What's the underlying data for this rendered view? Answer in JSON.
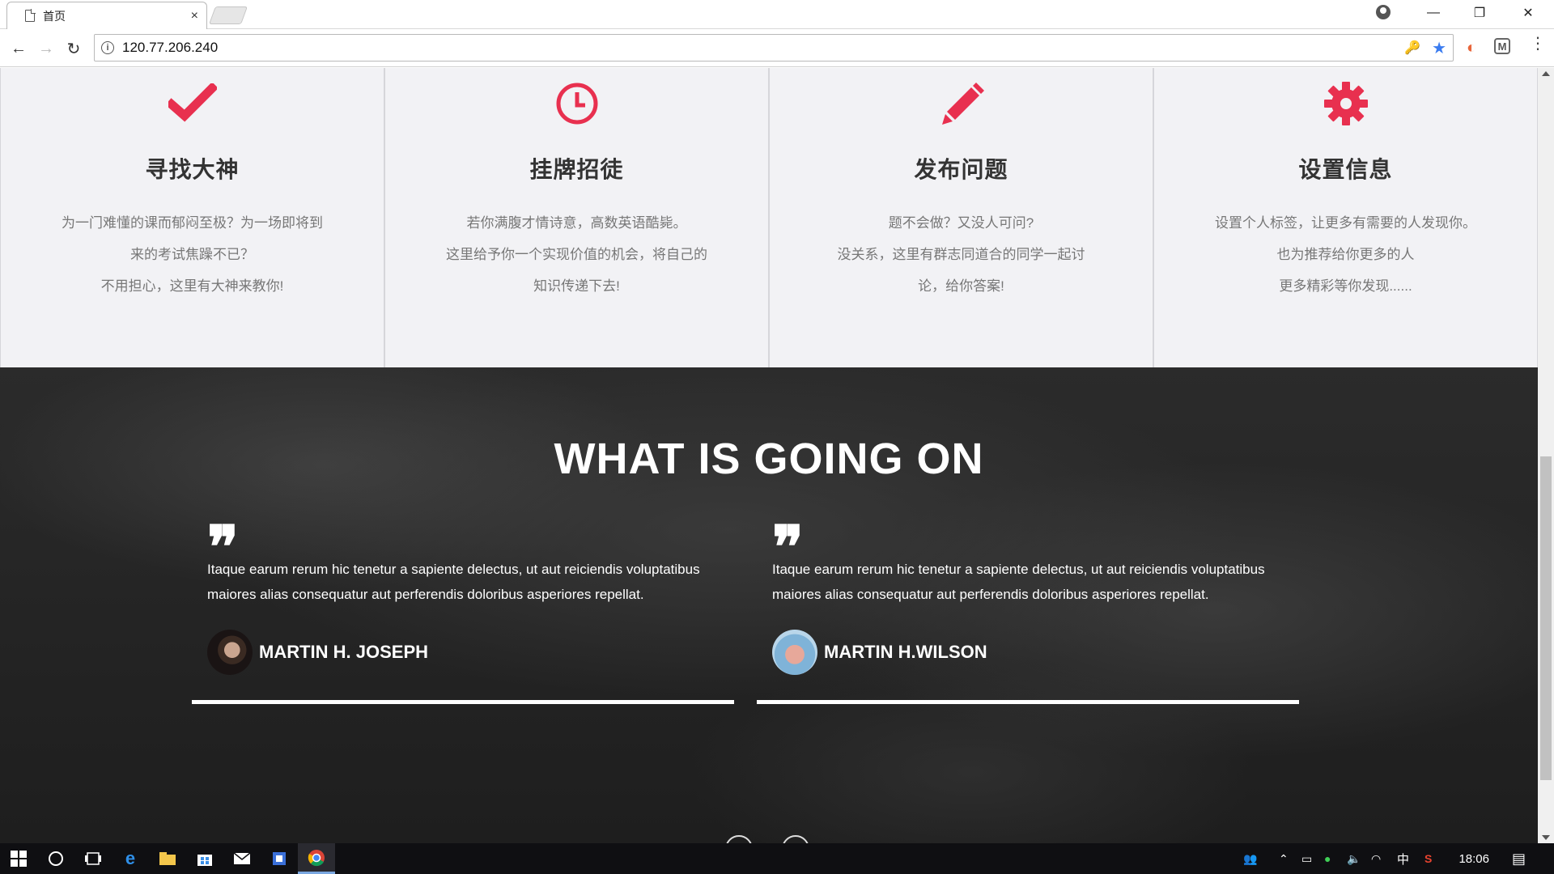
{
  "browser": {
    "tab_title": "首页",
    "tab_close": "×",
    "url": "120.77.206.240",
    "window_controls": {
      "minimize": "—",
      "restore": "❐",
      "close": "✕"
    },
    "nav": {
      "back": "←",
      "forward": "→",
      "reload": "↻"
    },
    "icons": {
      "info": "i",
      "key": "🔑",
      "star": "★",
      "ext_orange": "◐",
      "ext_m": "M",
      "menu": "⋮"
    }
  },
  "features": [
    {
      "icon": "check-icon",
      "title": "寻找大神",
      "lines": [
        "为一门难懂的课而郁闷至极？为一场即将到",
        "来的考试焦躁不已？",
        "不用担心，这里有大神来教你!"
      ]
    },
    {
      "icon": "clock-icon",
      "title": "挂牌招徒",
      "lines": [
        "若你满腹才情诗意，高数英语酷毙。",
        "这里给予你一个实现价值的机会，将自己的",
        "知识传递下去!"
      ]
    },
    {
      "icon": "pencil-icon",
      "title": "发布问题",
      "lines": [
        "题不会做？又没人可问?",
        "没关系，这里有群志同道合的同学一起讨",
        "论，给你答案!"
      ]
    },
    {
      "icon": "gear-icon",
      "title": "设置信息",
      "lines": [
        "设置个人标签，让更多有需要的人发现你。",
        "也为推荐给你更多的人",
        "更多精彩等你发现......"
      ]
    }
  ],
  "testimonials": {
    "title": "WHAT IS GOING ON",
    "quote_mark": "❞",
    "items": [
      {
        "text": "Itaque earum rerum hic tenetur a sapiente delectus, ut aut reiciendis voluptatibus maiores alias consequatur aut perferendis doloribus asperiores repellat.",
        "author": "MARTIN H. JOSEPH"
      },
      {
        "text": "Itaque earum rerum hic tenetur a sapiente delectus, ut aut reiciendis voluptatibus maiores alias consequatur aut perferendis doloribus asperiores repellat.",
        "author": "MARTIN H.WILSON"
      }
    ]
  },
  "taskbar": {
    "clock": "18:06",
    "ime": "中",
    "icons": [
      "windows-start-icon",
      "cortana-icon",
      "task-view-icon",
      "edge-icon",
      "file-explorer-icon",
      "store-icon",
      "mail-icon",
      "app-icon",
      "chrome-icon"
    ]
  },
  "colors": {
    "accent": "#e8304f",
    "dark_bg": "#262626",
    "feature_bg": "#f2f2f5"
  }
}
